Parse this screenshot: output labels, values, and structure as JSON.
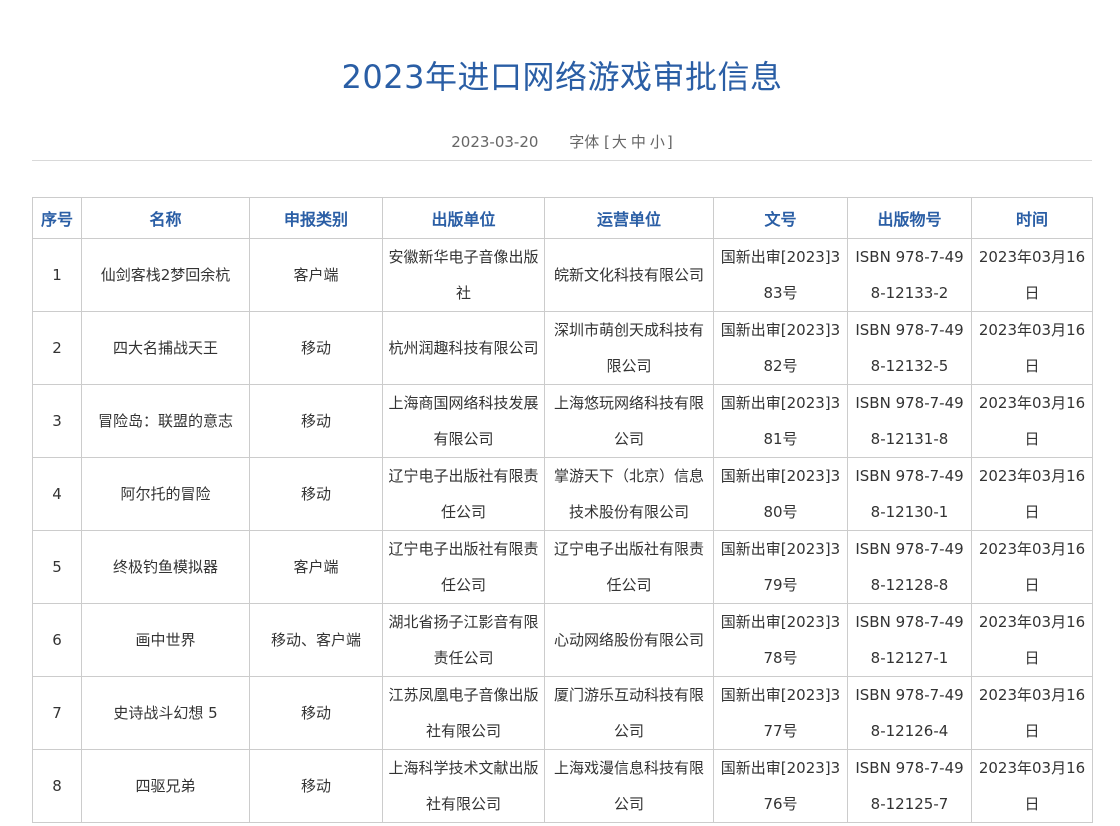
{
  "title": "2023年进口网络游戏审批信息",
  "meta": {
    "date": "2023-03-20",
    "font_label": "字体",
    "bracket_open": "[",
    "size_large": "大",
    "size_medium": "中",
    "size_small": "小",
    "bracket_close": "]"
  },
  "table": {
    "headers": [
      "序号",
      "名称",
      "申报类别",
      "出版单位",
      "运营单位",
      "文号",
      "出版物号",
      "时间"
    ],
    "rows": [
      {
        "no": "1",
        "name": "仙剑客栈2梦回余杭",
        "category": "客户端",
        "publisher": "安徽新华电子音像出版社",
        "operator": "皖新文化科技有限公司",
        "doc_no": "国新出审[2023]383号",
        "isbn": "ISBN 978-7-498-12133-2",
        "date": "2023年03月16日"
      },
      {
        "no": "2",
        "name": "四大名捕战天王",
        "category": "移动",
        "publisher": "杭州润趣科技有限公司",
        "operator": "深圳市萌创天成科技有限公司",
        "doc_no": "国新出审[2023]382号",
        "isbn": "ISBN 978-7-498-12132-5",
        "date": "2023年03月16日"
      },
      {
        "no": "3",
        "name": "冒险岛：联盟的意志",
        "category": "移动",
        "publisher": "上海商国网络科技发展有限公司",
        "operator": "上海悠玩网络科技有限公司",
        "doc_no": "国新出审[2023]381号",
        "isbn": "ISBN 978-7-498-12131-8",
        "date": "2023年03月16日"
      },
      {
        "no": "4",
        "name": "阿尔托的冒险",
        "category": "移动",
        "publisher": "辽宁电子出版社有限责任公司",
        "operator": "掌游天下（北京）信息技术股份有限公司",
        "doc_no": "国新出审[2023]380号",
        "isbn": "ISBN 978-7-498-12130-1",
        "date": "2023年03月16日"
      },
      {
        "no": "5",
        "name": "终极钓鱼模拟器",
        "category": "客户端",
        "publisher": "辽宁电子出版社有限责任公司",
        "operator": "辽宁电子出版社有限责任公司",
        "doc_no": "国新出审[2023]379号",
        "isbn": "ISBN 978-7-498-12128-8",
        "date": "2023年03月16日"
      },
      {
        "no": "6",
        "name": "画中世界",
        "category": "移动、客户端",
        "publisher": "湖北省扬子江影音有限责任公司",
        "operator": "心动网络股份有限公司",
        "doc_no": "国新出审[2023]378号",
        "isbn": "ISBN 978-7-498-12127-1",
        "date": "2023年03月16日"
      },
      {
        "no": "7",
        "name": "史诗战斗幻想 5",
        "category": "移动",
        "publisher": "江苏凤凰电子音像出版社有限公司",
        "operator": "厦门游乐互动科技有限公司",
        "doc_no": "国新出审[2023]377号",
        "isbn": "ISBN 978-7-498-12126-4",
        "date": "2023年03月16日"
      },
      {
        "no": "8",
        "name": "四驱兄弟",
        "category": "移动",
        "publisher": "上海科学技术文献出版社有限公司",
        "operator": "上海戏漫信息科技有限公司",
        "doc_no": "国新出审[2023]376号",
        "isbn": "ISBN 978-7-498-12125-7",
        "date": "2023年03月16日"
      }
    ]
  }
}
